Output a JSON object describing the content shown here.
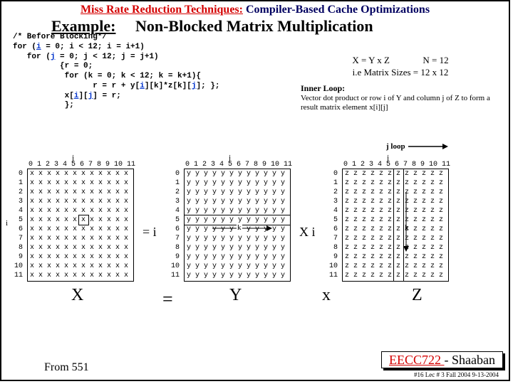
{
  "header": {
    "techniques": "Miss Rate Reduction Techniques:",
    "subtitle": "Compiler-Based Cache Optimizations"
  },
  "title": {
    "example": "Example:",
    "rest": "Non-Blocked Matrix Multiplication"
  },
  "code": {
    "l1": "/* Before Blocking*/",
    "l2a": "for (",
    "l2b": "i",
    "l2c": " = 0; i < 12; i = i+1)",
    "l3a": "   for (",
    "l3b": "j",
    "l3c": " = 0; j < 12; j = j+1)",
    "l4": "          {r = 0;",
    "l5": "           for (k = 0; k < 12; k = k+1){",
    "l6a": "                 r = r + y[",
    "l6b": "i",
    "l6c": "][k]*z[k][",
    "l6d": "j",
    "l6e": "]; };",
    "l7a": "           x[",
    "l7b": "i",
    "l7c": "][",
    "l7d": "j",
    "l7e": "] = r;",
    "l8": "           };"
  },
  "notes": {
    "eq": "X  = Y x  Z",
    "n12": "N = 12",
    "sizes": "i.e  Matrix Sizes = 12 x 12",
    "inner_t": "Inner Loop:",
    "inner_d": "Vector dot product or row i of Y and column j of Z to form a result matrix element x[i][j]"
  },
  "jloop": "j  loop",
  "axis": {
    "j": "j",
    "i": "i",
    "cols": "0 1 2 3 4 5 6 7 8 9 10 11",
    "rows": " 0\n 1\n 2\n 3\n 4\n 5\n 6\n 7\n 8\n 9\n10\n11"
  },
  "letters": {
    "x": "x",
    "y": "y",
    "z": "z"
  },
  "mat_labels": {
    "X": "X",
    "Y": "Y",
    "Z": "Z",
    "eq": "=",
    "mul": "x"
  },
  "ops": {
    "eq_i": "=   i",
    "mul": "X  i",
    "k": "k"
  },
  "footer": {
    "course": "EECC722 ",
    "inst": "- Shaaban",
    "lec": "#16  Lec # 3  Fall 2004  9-13-2004",
    "from": "From 551"
  }
}
